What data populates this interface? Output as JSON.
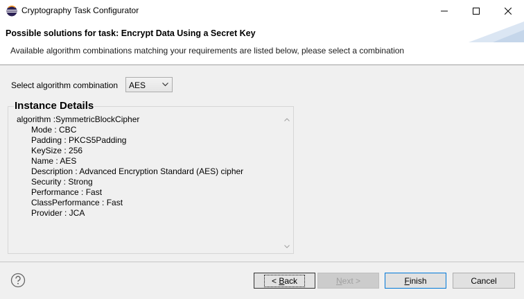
{
  "window": {
    "title": "Cryptography Task Configurator"
  },
  "header": {
    "title": "Possible solutions for task: Encrypt Data Using a Secret Key",
    "description": "Available algorithm combinations matching your requirements are listed below, please select a combination"
  },
  "selection": {
    "label": "Select algorithm combination",
    "value": "AES"
  },
  "details": {
    "title": "Instance Details",
    "algorithm_line": "algorithm :SymmetricBlockCipher",
    "lines": [
      "Mode : CBC",
      "Padding : PKCS5Padding",
      "KeySize : 256",
      "Name : AES",
      "Description : Advanced Encryption Standard (AES) cipher",
      "Security : Strong",
      "Performance : Fast",
      "ClassPerformance : Fast",
      "Provider : JCA"
    ]
  },
  "buttons": {
    "back_mnemonic": "B",
    "back_rest": "ack",
    "back_prefix": "< ",
    "next_mnemonic": "N",
    "next_rest": "ext >",
    "finish_mnemonic": "F",
    "finish_rest": "inish",
    "cancel": "Cancel"
  },
  "colors": {
    "accent": "#0078d7",
    "app_icon_blue": "#2c2255",
    "app_icon_orange": "#f7941e"
  },
  "icons": {
    "app": "eclipse-icon",
    "help": "help-icon",
    "minimize": "minimize-icon",
    "maximize": "maximize-icon",
    "close": "close-icon",
    "dropdown": "chevron-down-icon"
  }
}
